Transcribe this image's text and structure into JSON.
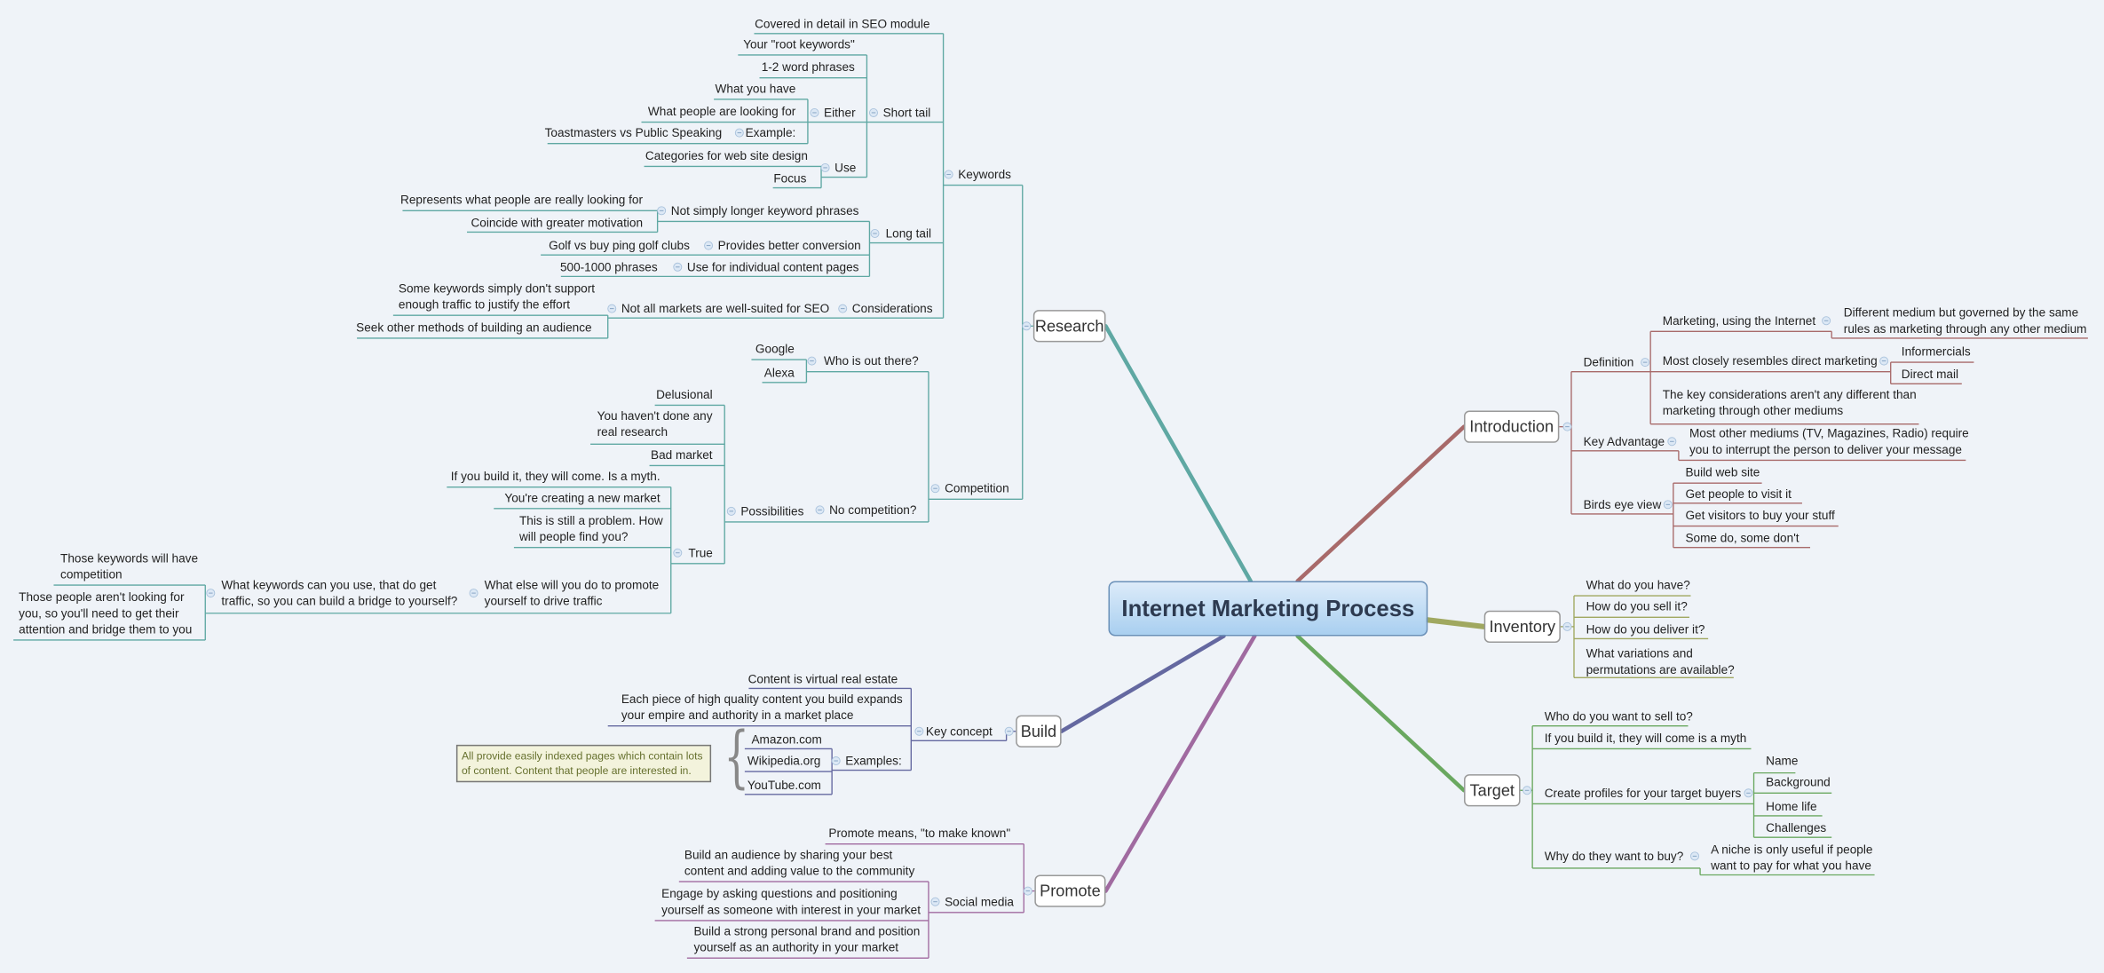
{
  "title": "Internet Marketing Process",
  "colors": {
    "research": "#5fa8a3",
    "introduction": "#a86a6a",
    "inventory": "#a0a860",
    "target": "#6aa860",
    "build": "#6468a0",
    "promote": "#a06aa0",
    "central": "#a9cff0"
  },
  "research": {
    "label": "Research",
    "keywords": {
      "label": "Keywords",
      "seo_note": "Covered in detail in SEO module",
      "short_tail": {
        "label": "Short tail",
        "items": [
          "Your \"root keywords\"",
          "1-2 word phrases"
        ],
        "either": {
          "label": "Either",
          "items": [
            "What you have",
            "What people are looking for"
          ],
          "example_label": "Example:",
          "example": "Toastmasters vs Public Speaking"
        },
        "use": {
          "label": "Use",
          "items": [
            "Categories for web site design",
            "Focus"
          ]
        }
      },
      "long_tail": {
        "label": "Long tail",
        "not_simply": {
          "label": "Not simply longer keyword phrases",
          "items": [
            "Represents what people are really looking for",
            "Coincide with greater motivation"
          ]
        },
        "conversion": {
          "label": "Provides better conversion",
          "example": "Golf vs buy ping golf clubs"
        },
        "content_pages": {
          "label": "Use for individual content pages",
          "detail": "500-1000 phrases"
        }
      },
      "considerations": {
        "label": "Considerations",
        "not_all": {
          "label": "Not all markets are well-suited for SEO",
          "items": [
            "Some keywords simply don't support\nenough traffic to justify the effort",
            "Seek other methods of building an audience"
          ]
        }
      }
    },
    "competition": {
      "label": "Competition",
      "who": {
        "label": "Who is out there?",
        "items": [
          "Google",
          "Alexa"
        ]
      },
      "no_comp": {
        "label": "No competition?"
      },
      "possibilities": {
        "label": "Possibilities",
        "items": [
          "Delusional",
          "You haven't done any\nreal research",
          "Bad market"
        ],
        "true": {
          "label": "True",
          "items": [
            "If you build it, they will come. Is a myth.",
            "You're creating a new market",
            "This is still a problem. How\nwill people find you?"
          ],
          "promote": {
            "label": "What else will you do to promote\nyourself to drive traffic",
            "bridge": {
              "label": "What keywords can you use, that do get\ntraffic, so you can build a bridge to yourself?",
              "items": [
                "Those keywords will have\ncompetition",
                "Those people aren't looking for\nyou, so you'll need to get their\nattention and bridge them to you"
              ]
            }
          }
        }
      }
    }
  },
  "build": {
    "label": "Build",
    "key_concept": {
      "label": "Key concept",
      "items": [
        "Content is virtual real estate",
        "Each piece of high quality content you build expands\nyour empire and authority in a market place"
      ],
      "examples": {
        "label": "Examples:",
        "items": [
          "Amazon.com",
          "Wikipedia.org",
          "YouTube.com"
        ]
      }
    },
    "note": "All provide easily indexed pages which contain lots\nof content. Content that people are interested in."
  },
  "promote": {
    "label": "Promote",
    "means": "Promote means, \"to make known\"",
    "social": {
      "label": "Social media",
      "items": [
        "Build an audience by sharing your best\ncontent and adding value to the community",
        "Engage by asking questions and positioning\nyourself as someone with interest in your market",
        "Build a strong personal brand and position\nyourself as an authority in your market"
      ]
    }
  },
  "introduction": {
    "label": "Introduction",
    "definition": {
      "label": "Definition",
      "marketing": {
        "label": "Marketing, using the Internet",
        "detail": "Different medium but governed by the same\nrules as marketing through any other medium"
      },
      "resembles": {
        "label": "Most closely resembles direct marketing",
        "items": [
          "Informercials",
          "Direct mail"
        ]
      },
      "considerations": "The key considerations aren't any different than\nmarketing through other mediums"
    },
    "key_advantage": {
      "label": "Key Advantage",
      "detail": "Most other mediums (TV, Magazines, Radio) require\nyou to interrupt the person to deliver your message"
    },
    "birds_eye": {
      "label": "Birds eye view",
      "items": [
        "Build web site",
        "Get people to visit it",
        "Get visitors to buy your stuff",
        "Some do, some don't"
      ]
    }
  },
  "inventory": {
    "label": "Inventory",
    "items": [
      "What do you have?",
      "How do you sell it?",
      "How do you deliver it?",
      "What variations and\npermutations are available?"
    ]
  },
  "target": {
    "label": "Target",
    "items": [
      "Who do you want to sell to?",
      "If you build it, they will come is a myth"
    ],
    "profiles": {
      "label": "Create profiles for your target buyers",
      "items": [
        "Name",
        "Background",
        "Home life",
        "Challenges"
      ]
    },
    "why": {
      "label": "Why do they want to buy?",
      "detail": "A niche is only useful if people\nwant to pay for what you have"
    }
  }
}
